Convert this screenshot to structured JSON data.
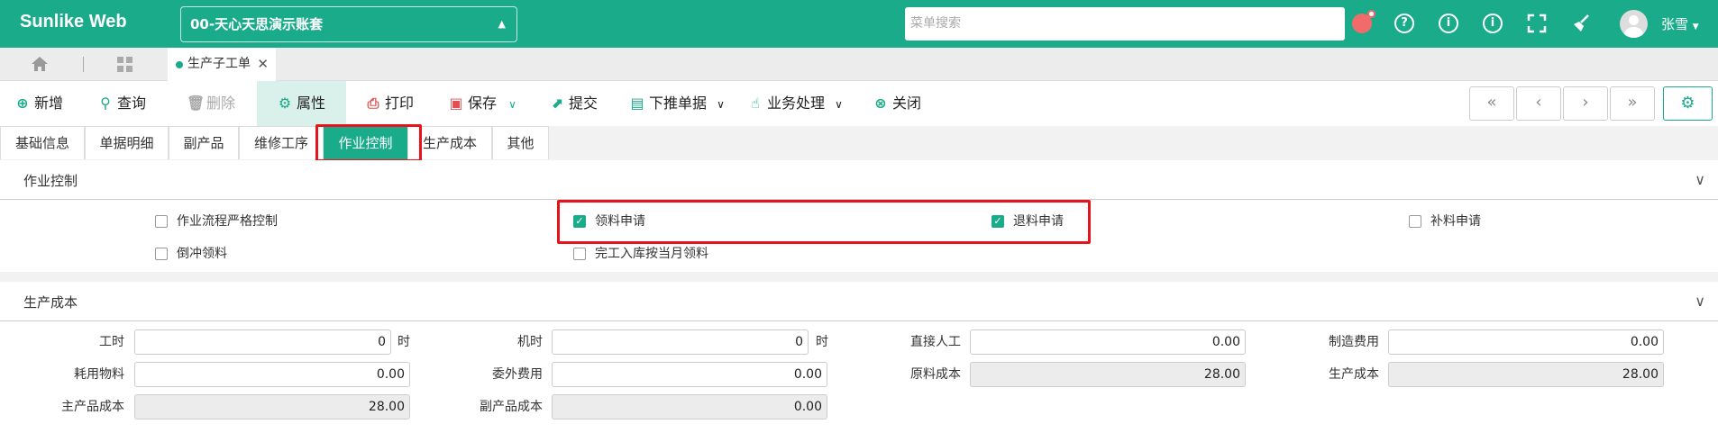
{
  "header": {
    "brand": "Sunlike Web",
    "account": "00-天心天思演示账套",
    "search_placeholder": "菜单搜索",
    "user": "张雪",
    "bg_color": "#1aab8a"
  },
  "tabstrip": {
    "open_tab": "生产子工单"
  },
  "toolbar": {
    "buttons": [
      {
        "label": "新增",
        "icon": "plus-circle-icon"
      },
      {
        "label": "查询",
        "icon": "search-icon"
      },
      {
        "label": "删除",
        "icon": "trash-icon"
      },
      {
        "label": "属性",
        "icon": "gear-icon"
      },
      {
        "label": "打印",
        "icon": "printer-icon"
      },
      {
        "label": "保存",
        "icon": "save-icon"
      },
      {
        "label": "提交",
        "icon": "submit-icon"
      },
      {
        "label": "下推单据",
        "icon": "push-doc-icon"
      },
      {
        "label": "业务处理",
        "icon": "hand-pointer-icon"
      },
      {
        "label": "关闭",
        "icon": "close-circle-icon"
      }
    ]
  },
  "subtabs": [
    "基础信息",
    "单据明细",
    "副产品",
    "维修工序",
    "作业控制",
    "生产成本",
    "其他"
  ],
  "control": {
    "title": "作业控制",
    "options": [
      {
        "label": "作业流程严格控制",
        "checked": false
      },
      {
        "label": "领料申请",
        "checked": true
      },
      {
        "label": "退料申请",
        "checked": true
      },
      {
        "label": "补料申请",
        "checked": false
      },
      {
        "label": "倒冲领料",
        "checked": false
      },
      {
        "label": "完工入库按当月领料",
        "checked": false
      }
    ]
  },
  "cost": {
    "title": "生产成本",
    "unit": "时",
    "fields": [
      {
        "label": "工时",
        "value": "0"
      },
      {
        "label": "机时",
        "value": "0"
      },
      {
        "label": "直接人工",
        "value": "0.00"
      },
      {
        "label": "制造费用",
        "value": "0.00"
      },
      {
        "label": "耗用物料",
        "value": "0.00"
      },
      {
        "label": "委外费用",
        "value": "0.00"
      },
      {
        "label": "原料成本",
        "value": "28.00"
      },
      {
        "label": "生产成本",
        "value": "28.00"
      },
      {
        "label": "主产品成本",
        "value": "28.00"
      },
      {
        "label": "副产品成本",
        "value": "0.00"
      }
    ]
  }
}
